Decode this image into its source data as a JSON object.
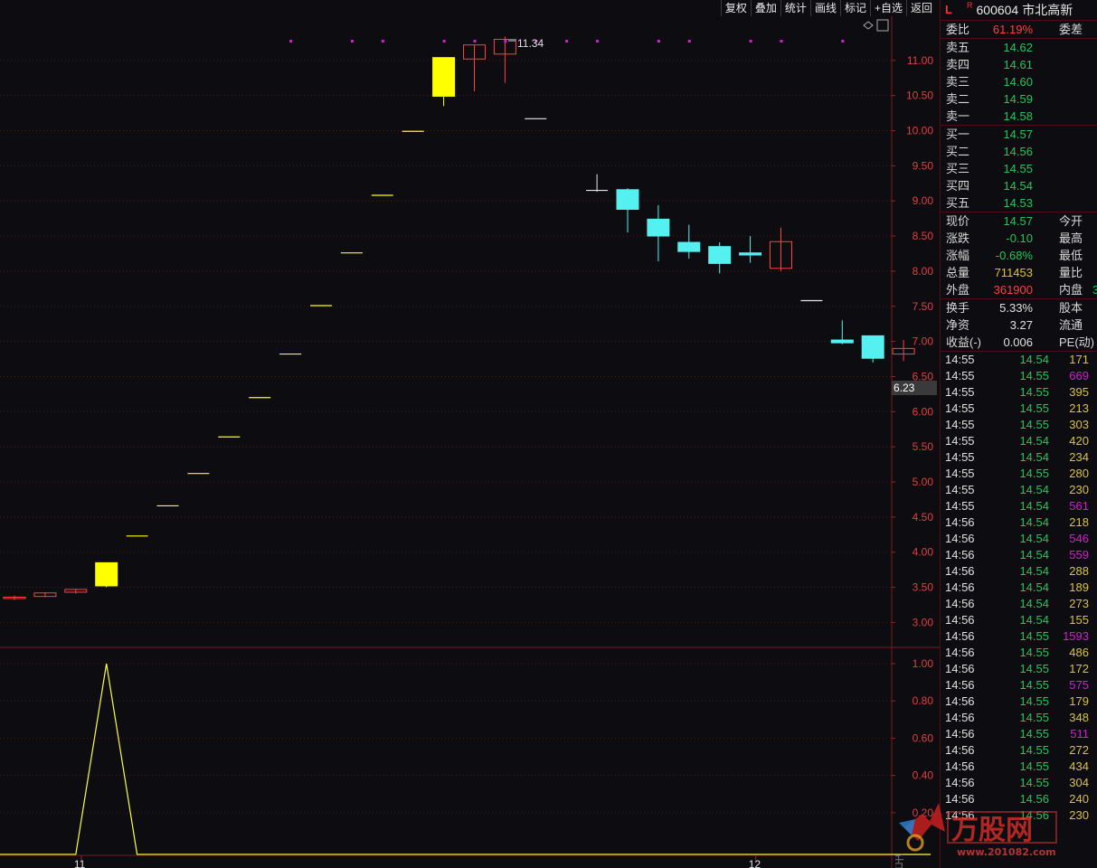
{
  "toolbar": {
    "items": [
      "复权",
      "叠加",
      "统计",
      "画线",
      "标记",
      "+自选",
      "返回"
    ]
  },
  "header": {
    "flag": "L",
    "badge": "R",
    "code": "600604",
    "name": "市北高新"
  },
  "weibi": {
    "label": "委比",
    "value": "61.19%",
    "label2": "委差"
  },
  "sell": [
    {
      "label": "卖五",
      "price": "14.62"
    },
    {
      "label": "卖四",
      "price": "14.61"
    },
    {
      "label": "卖三",
      "price": "14.60"
    },
    {
      "label": "卖二",
      "price": "14.59"
    },
    {
      "label": "卖一",
      "price": "14.58"
    }
  ],
  "buy": [
    {
      "label": "买一",
      "price": "14.57"
    },
    {
      "label": "买二",
      "price": "14.56"
    },
    {
      "label": "买三",
      "price": "14.55"
    },
    {
      "label": "买四",
      "price": "14.54"
    },
    {
      "label": "买五",
      "price": "14.53"
    }
  ],
  "quote1": [
    {
      "label": "现价",
      "value": "14.57",
      "color": "green",
      "label2": "今开"
    },
    {
      "label": "涨跌",
      "value": "-0.10",
      "color": "green",
      "label2": "最高"
    },
    {
      "label": "涨幅",
      "value": "-0.68%",
      "color": "green",
      "label2": "最低"
    },
    {
      "label": "总量",
      "value": "711453",
      "color": "yellow",
      "label2": "量比"
    },
    {
      "label": "外盘",
      "value": "361900",
      "color": "red",
      "label2": "内盘",
      "value2": "3"
    }
  ],
  "quote2": [
    {
      "label": "换手",
      "value": "5.33%",
      "color": "white",
      "label2": "股本"
    },
    {
      "label": "净资",
      "value": "3.27",
      "color": "white",
      "label2": "流通"
    },
    {
      "label": "收益(-)",
      "value": "0.006",
      "color": "white",
      "label2": "PE(动)"
    }
  ],
  "ticks": [
    {
      "time": "14:55",
      "price": "14.54",
      "vol": "171",
      "pc": "green",
      "vc": "yellow"
    },
    {
      "time": "14:55",
      "price": "14.55",
      "vol": "669",
      "pc": "green",
      "vc": "magenta"
    },
    {
      "time": "14:55",
      "price": "14.55",
      "vol": "395",
      "pc": "green",
      "vc": "yellow"
    },
    {
      "time": "14:55",
      "price": "14.55",
      "vol": "213",
      "pc": "green",
      "vc": "yellow"
    },
    {
      "time": "14:55",
      "price": "14.55",
      "vol": "303",
      "pc": "green",
      "vc": "yellow"
    },
    {
      "time": "14:55",
      "price": "14.54",
      "vol": "420",
      "pc": "green",
      "vc": "yellow"
    },
    {
      "time": "14:55",
      "price": "14.54",
      "vol": "234",
      "pc": "green",
      "vc": "yellow"
    },
    {
      "time": "14:55",
      "price": "14.55",
      "vol": "280",
      "pc": "green",
      "vc": "yellow"
    },
    {
      "time": "14:55",
      "price": "14.54",
      "vol": "230",
      "pc": "green",
      "vc": "yellow"
    },
    {
      "time": "14:55",
      "price": "14.54",
      "vol": "561",
      "pc": "green",
      "vc": "magenta"
    },
    {
      "time": "14:56",
      "price": "14.54",
      "vol": "218",
      "pc": "green",
      "vc": "yellow"
    },
    {
      "time": "14:56",
      "price": "14.54",
      "vol": "546",
      "pc": "green",
      "vc": "magenta"
    },
    {
      "time": "14:56",
      "price": "14.54",
      "vol": "559",
      "pc": "green",
      "vc": "magenta"
    },
    {
      "time": "14:56",
      "price": "14.54",
      "vol": "288",
      "pc": "green",
      "vc": "yellow"
    },
    {
      "time": "14:56",
      "price": "14.54",
      "vol": "189",
      "pc": "green",
      "vc": "yellow"
    },
    {
      "time": "14:56",
      "price": "14.54",
      "vol": "273",
      "pc": "green",
      "vc": "yellow"
    },
    {
      "time": "14:56",
      "price": "14.54",
      "vol": "155",
      "pc": "green",
      "vc": "yellow"
    },
    {
      "time": "14:56",
      "price": "14.55",
      "vol": "1593",
      "pc": "green",
      "vc": "magenta"
    },
    {
      "time": "14:56",
      "price": "14.55",
      "vol": "486",
      "pc": "green",
      "vc": "yellow"
    },
    {
      "time": "14:56",
      "price": "14.55",
      "vol": "172",
      "pc": "green",
      "vc": "yellow"
    },
    {
      "time": "14:56",
      "price": "14.55",
      "vol": "575",
      "pc": "green",
      "vc": "magenta"
    },
    {
      "time": "14:56",
      "price": "14.55",
      "vol": "179",
      "pc": "green",
      "vc": "yellow"
    },
    {
      "time": "14:56",
      "price": "14.55",
      "vol": "348",
      "pc": "green",
      "vc": "yellow"
    },
    {
      "time": "14:56",
      "price": "14.55",
      "vol": "511",
      "pc": "green",
      "vc": "magenta"
    },
    {
      "time": "14:56",
      "price": "14.55",
      "vol": "272",
      "pc": "green",
      "vc": "yellow"
    },
    {
      "time": "14:56",
      "price": "14.55",
      "vol": "434",
      "pc": "green",
      "vc": "yellow"
    },
    {
      "time": "14:56",
      "price": "14.55",
      "vol": "304",
      "pc": "green",
      "vc": "yellow"
    },
    {
      "time": "14:56",
      "price": "14.56",
      "vol": "240",
      "pc": "green",
      "vc": "yellow"
    },
    {
      "time": "14:56",
      "price": "14.56",
      "vol": "230",
      "pc": "green",
      "vc": "yellow"
    }
  ],
  "chart_data": {
    "type": "candlestick",
    "price_axis": {
      "ticks": [
        "11.00",
        "10.50",
        "10.00",
        "9.50",
        "9.00",
        "8.50",
        "8.00",
        "7.50",
        "7.00",
        "6.50",
        "6.00",
        "5.50",
        "5.00",
        "4.50",
        "4.00",
        "3.50",
        "3.00"
      ],
      "range": [
        2.5,
        11.8
      ]
    },
    "high_marker": "11.34",
    "current_marker": "6.23",
    "candles": [
      {
        "o": 3.34,
        "h": 3.38,
        "l": 3.32,
        "c": 3.36,
        "kind": "up"
      },
      {
        "o": 3.37,
        "h": 3.43,
        "l": 3.36,
        "c": 3.42,
        "kind": "up"
      },
      {
        "o": 3.43,
        "h": 3.48,
        "l": 3.41,
        "c": 3.47,
        "kind": "up"
      },
      {
        "o": 3.52,
        "h": 3.85,
        "l": 3.5,
        "c": 3.85,
        "kind": "limit"
      },
      {
        "o": 4.23,
        "h": 4.23,
        "l": 4.23,
        "c": 4.23,
        "kind": "limit"
      },
      {
        "o": 4.66,
        "h": 4.66,
        "l": 4.66,
        "c": 4.66,
        "kind": "limit"
      },
      {
        "o": 5.12,
        "h": 5.12,
        "l": 5.12,
        "c": 5.12,
        "kind": "limit"
      },
      {
        "o": 5.64,
        "h": 5.64,
        "l": 5.64,
        "c": 5.64,
        "kind": "limit"
      },
      {
        "o": 6.2,
        "h": 6.2,
        "l": 6.2,
        "c": 6.2,
        "kind": "limit"
      },
      {
        "o": 6.82,
        "h": 6.82,
        "l": 6.82,
        "c": 6.82,
        "kind": "limit"
      },
      {
        "o": 7.51,
        "h": 7.51,
        "l": 7.51,
        "c": 7.51,
        "kind": "limit"
      },
      {
        "o": 8.26,
        "h": 8.26,
        "l": 8.26,
        "c": 8.26,
        "kind": "limit"
      },
      {
        "o": 9.08,
        "h": 9.08,
        "l": 9.08,
        "c": 9.08,
        "kind": "limit"
      },
      {
        "o": 9.99,
        "h": 9.99,
        "l": 9.99,
        "c": 9.99,
        "kind": "limit"
      },
      {
        "o": 10.49,
        "h": 11.04,
        "l": 10.35,
        "c": 11.04,
        "kind": "limit"
      },
      {
        "o": 11.02,
        "h": 11.22,
        "l": 10.56,
        "c": 11.22,
        "kind": "up"
      },
      {
        "o": 11.09,
        "h": 11.34,
        "l": 10.68,
        "c": 11.3,
        "kind": "up"
      },
      {
        "o": 10.17,
        "h": 10.17,
        "l": 10.17,
        "c": 10.17,
        "kind": "flatwhite"
      },
      null,
      {
        "o": 9.15,
        "h": 9.38,
        "l": 9.13,
        "c": 9.15,
        "kind": "flatwhite"
      },
      {
        "o": 9.16,
        "h": 9.18,
        "l": 8.55,
        "c": 8.88,
        "kind": "down"
      },
      {
        "o": 8.74,
        "h": 8.94,
        "l": 8.14,
        "c": 8.5,
        "kind": "down"
      },
      {
        "o": 8.41,
        "h": 8.66,
        "l": 8.18,
        "c": 8.28,
        "kind": "down"
      },
      {
        "o": 8.35,
        "h": 8.41,
        "l": 7.97,
        "c": 8.11,
        "kind": "down"
      },
      {
        "o": 8.26,
        "h": 8.5,
        "l": 8.12,
        "c": 8.23,
        "kind": "down"
      },
      {
        "o": 8.04,
        "h": 8.62,
        "l": 8.0,
        "c": 8.42,
        "kind": "up"
      },
      {
        "o": 7.58,
        "h": 7.58,
        "l": 7.58,
        "c": 7.58,
        "kind": "flatwhite"
      },
      {
        "o": 7.02,
        "h": 7.3,
        "l": 6.96,
        "c": 6.98,
        "kind": "down"
      },
      {
        "o": 7.08,
        "h": 7.08,
        "l": 6.7,
        "c": 6.76,
        "kind": "down"
      },
      {
        "o": 6.82,
        "h": 7.02,
        "l": 6.72,
        "c": 6.9,
        "kind": "up"
      }
    ],
    "markers": [
      9,
      11,
      12,
      14,
      15,
      16,
      17,
      18,
      19,
      21,
      22,
      24,
      25,
      27
    ],
    "indicator": {
      "ticks": [
        "1.00",
        "0.80",
        "0.60",
        "0.40",
        "0.20"
      ],
      "range": [
        0,
        1.05
      ],
      "values": [
        0,
        0,
        0,
        1,
        0,
        0,
        0,
        0,
        0,
        0,
        0,
        0,
        0,
        0,
        0,
        0,
        0,
        0,
        0,
        0,
        0,
        0,
        0,
        0,
        0,
        0,
        0,
        0,
        0,
        0
      ]
    },
    "date_labels": [
      {
        "candle_index": 1,
        "text": "11"
      },
      {
        "candle_index": 23,
        "text": "12"
      }
    ]
  }
}
